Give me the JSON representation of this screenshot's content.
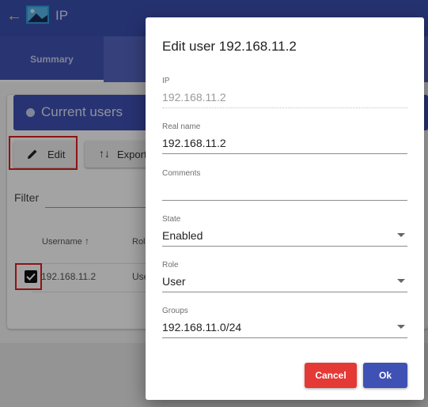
{
  "app": {
    "title": "IP",
    "back_icon": "arrow-left-icon",
    "logo_icon": "image-icon"
  },
  "tabs": [
    {
      "label": "Summary",
      "active": true
    }
  ],
  "users_card": {
    "title": "Current users",
    "title_icon": "user-circle-icon",
    "edit_label": "Edit",
    "export_label": "Export",
    "filter_label": "Filter",
    "columns": {
      "username": "Username",
      "role": "Rol"
    },
    "rows": [
      {
        "username": "192.168.11.2",
        "role": "Use",
        "selected": true
      }
    ]
  },
  "dialog": {
    "title": "Edit user 192.168.11.2",
    "ip_label": "IP",
    "ip_value": "192.168.11.2",
    "realname_label": "Real name",
    "realname_value": "192.168.11.2",
    "comments_label": "Comments",
    "comments_value": "",
    "state_label": "State",
    "state_value": "Enabled",
    "role_label": "Role",
    "role_value": "User",
    "groups_label": "Groups",
    "groups_value": "192.168.11.0/24",
    "cancel_label": "Cancel",
    "ok_label": "Ok"
  },
  "colors": {
    "primary": "#3f51b5",
    "cancel": "#e53935",
    "highlight": "#e01e1e",
    "back_arrow": "#f2d24b"
  }
}
